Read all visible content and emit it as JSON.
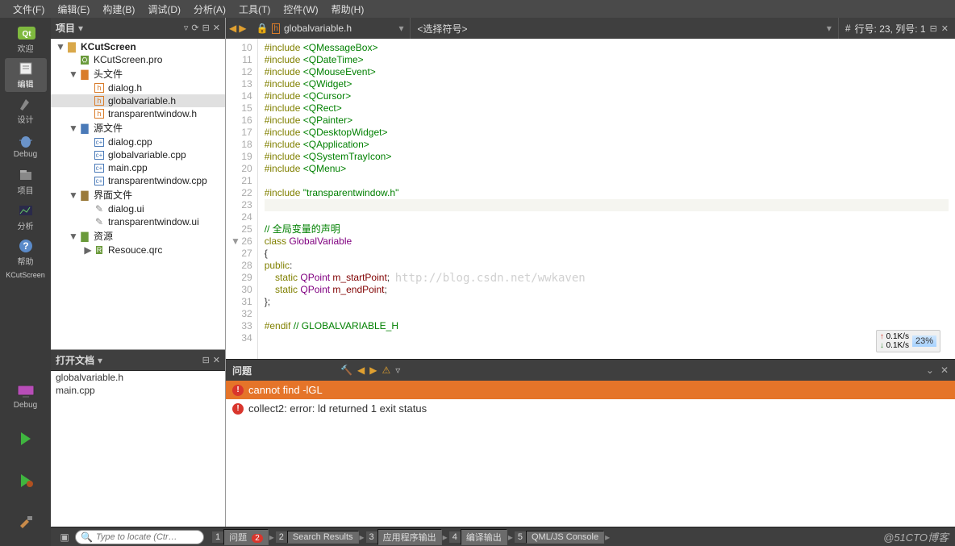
{
  "menubar": [
    "文件(F)",
    "编辑(E)",
    "构建(B)",
    "调试(D)",
    "分析(A)",
    "工具(T)",
    "控件(W)",
    "帮助(H)"
  ],
  "leftbar": {
    "modes": [
      {
        "label": "欢迎",
        "icon": "qt"
      },
      {
        "label": "编辑",
        "icon": "edit",
        "active": true
      },
      {
        "label": "设计",
        "icon": "design"
      },
      {
        "label": "Debug",
        "icon": "bug"
      },
      {
        "label": "项目",
        "icon": "project"
      },
      {
        "label": "分析",
        "icon": "analyze"
      },
      {
        "label": "帮助",
        "icon": "help"
      }
    ],
    "target_name": "KCutScreen",
    "target_config": "Debug"
  },
  "project_panel": {
    "title": "项目",
    "tree": [
      {
        "level": 0,
        "caret": "▼",
        "icon": "folder",
        "label": "KCutScreen",
        "bold": true
      },
      {
        "level": 1,
        "caret": "",
        "icon": "pro",
        "label": "KCutScreen.pro"
      },
      {
        "level": 1,
        "caret": "▼",
        "icon": "hfolder",
        "label": "头文件"
      },
      {
        "level": 2,
        "caret": "",
        "icon": "h",
        "label": "dialog.h"
      },
      {
        "level": 2,
        "caret": "",
        "icon": "h",
        "label": "globalvariable.h",
        "selected": true
      },
      {
        "level": 2,
        "caret": "",
        "icon": "h",
        "label": "transparentwindow.h"
      },
      {
        "level": 1,
        "caret": "▼",
        "icon": "cfolder",
        "label": "源文件"
      },
      {
        "level": 2,
        "caret": "",
        "icon": "cpp",
        "label": "dialog.cpp"
      },
      {
        "level": 2,
        "caret": "",
        "icon": "cpp",
        "label": "globalvariable.cpp"
      },
      {
        "level": 2,
        "caret": "",
        "icon": "cpp",
        "label": "main.cpp"
      },
      {
        "level": 2,
        "caret": "",
        "icon": "cpp",
        "label": "transparentwindow.cpp"
      },
      {
        "level": 1,
        "caret": "▼",
        "icon": "ufolder",
        "label": "界面文件"
      },
      {
        "level": 2,
        "caret": "",
        "icon": "ui",
        "label": "dialog.ui"
      },
      {
        "level": 2,
        "caret": "",
        "icon": "ui",
        "label": "transparentwindow.ui"
      },
      {
        "level": 1,
        "caret": "▼",
        "icon": "rfolder",
        "label": "资源"
      },
      {
        "level": 2,
        "caret": "▶",
        "icon": "qrc",
        "label": "Resouce.qrc"
      }
    ]
  },
  "open_docs": {
    "title": "打开文档",
    "items": [
      "globalvariable.h",
      "main.cpp"
    ]
  },
  "editor": {
    "crumb_file": "globalvariable.h",
    "crumb_symbol": "<选择符号>",
    "status_line": "行号: 23, 列号: 1",
    "status_hash": "#",
    "lines": [
      {
        "n": 10,
        "html": "<span class='kw'>#include</span> <span class='incl'>&lt;QMessageBox&gt;</span>"
      },
      {
        "n": 11,
        "html": "<span class='kw'>#include</span> <span class='incl'>&lt;QDateTime&gt;</span>"
      },
      {
        "n": 12,
        "html": "<span class='kw'>#include</span> <span class='incl'>&lt;QMouseEvent&gt;</span>"
      },
      {
        "n": 13,
        "html": "<span class='kw'>#include</span> <span class='incl'>&lt;QWidget&gt;</span>"
      },
      {
        "n": 14,
        "html": "<span class='kw'>#include</span> <span class='incl'>&lt;QCursor&gt;</span>"
      },
      {
        "n": 15,
        "html": "<span class='kw'>#include</span> <span class='incl'>&lt;QRect&gt;</span>"
      },
      {
        "n": 16,
        "html": "<span class='kw'>#include</span> <span class='incl'>&lt;QPainter&gt;</span>"
      },
      {
        "n": 17,
        "html": "<span class='kw'>#include</span> <span class='incl'>&lt;QDesktopWidget&gt;</span>"
      },
      {
        "n": 18,
        "html": "<span class='kw'>#include</span> <span class='incl'>&lt;QApplication&gt;</span>"
      },
      {
        "n": 19,
        "html": "<span class='kw'>#include</span> <span class='incl'>&lt;QSystemTrayIcon&gt;</span>"
      },
      {
        "n": 20,
        "html": "<span class='kw'>#include</span> <span class='incl'>&lt;QMenu&gt;</span>"
      },
      {
        "n": 21,
        "html": ""
      },
      {
        "n": 22,
        "html": "<span class='kw'>#include</span> <span class='str'>\"transparentwindow.h\"</span>"
      },
      {
        "n": 23,
        "html": "",
        "cursor": true
      },
      {
        "n": 24,
        "html": ""
      },
      {
        "n": 25,
        "html": "<span class='cmt'>// 全局变量的声明</span>"
      },
      {
        "n": 26,
        "fold": "▼",
        "html": "<span class='kw'>class</span> <span class='cls'>GlobalVariable</span>"
      },
      {
        "n": 27,
        "html": "{"
      },
      {
        "n": 28,
        "html": "<span class='kw'>public</span>:"
      },
      {
        "n": 29,
        "html": "    <span class='kw'>static</span> <span class='cls'>QPoint</span> <span class='mem'>m_startPoint</span>;"
      },
      {
        "n": 30,
        "html": "    <span class='kw'>static</span> <span class='cls'>QPoint</span> <span class='mem'>m_endPoint</span>;"
      },
      {
        "n": 31,
        "html": "};"
      },
      {
        "n": 32,
        "html": ""
      },
      {
        "n": 33,
        "html": "<span class='kw'>#endif</span> <span class='cmt'>// GLOBALVARIABLE_H</span>"
      },
      {
        "n": 34,
        "html": ""
      }
    ],
    "net": {
      "up": "0.1K/s",
      "down": "0.1K/s",
      "pct": "23%"
    }
  },
  "issues": {
    "title": "问题",
    "rows": [
      {
        "kind": "error-highlight",
        "text": "cannot find -lGL"
      },
      {
        "kind": "error",
        "text": "collect2: error: ld returned 1 exit status"
      }
    ]
  },
  "statusbar": {
    "locator_placeholder": "Type to locate (Ctr…",
    "tabs": [
      {
        "n": "1",
        "label": "问题",
        "badge": "2"
      },
      {
        "n": "2",
        "label": "Search Results"
      },
      {
        "n": "3",
        "label": "应用程序输出"
      },
      {
        "n": "4",
        "label": "编译输出"
      },
      {
        "n": "5",
        "label": "QML/JS Console"
      }
    ]
  },
  "watermark": "http://blog.csdn.net/wwkaven",
  "watermark2": "@51CTO博客"
}
